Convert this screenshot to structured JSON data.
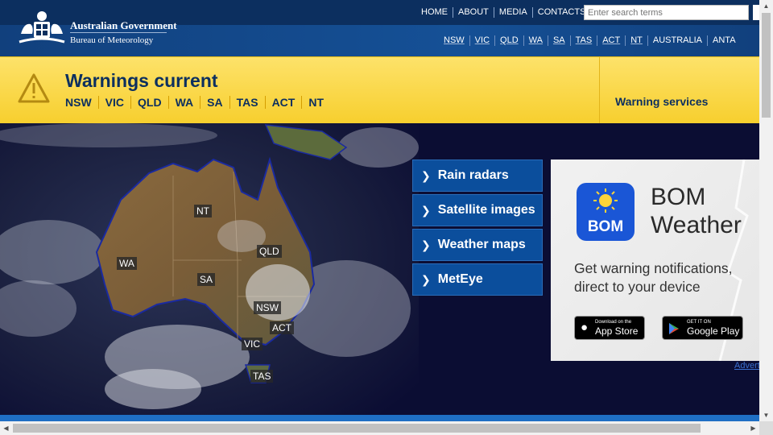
{
  "header": {
    "org_line1": "Australian Government",
    "org_line2": "Bureau of Meteorology",
    "top_links": [
      "HOME",
      "ABOUT",
      "MEDIA",
      "CONTACTS"
    ],
    "search_placeholder": "Enter search terms",
    "state_links": [
      "NSW",
      "VIC",
      "QLD",
      "WA",
      "SA",
      "TAS",
      "ACT",
      "NT",
      "AUSTRALIA",
      "ANTA"
    ]
  },
  "warnings": {
    "title": "Warnings current",
    "states": [
      "NSW",
      "VIC",
      "QLD",
      "WA",
      "SA",
      "TAS",
      "ACT",
      "NT"
    ],
    "services_link": "Warning services"
  },
  "map": {
    "labels": {
      "nt": "NT",
      "wa": "WA",
      "qld": "QLD",
      "sa": "SA",
      "nsw": "NSW",
      "act": "ACT",
      "vic": "VIC",
      "tas": "TAS"
    }
  },
  "menu": [
    "Rain radars",
    "Satellite images",
    "Weather maps",
    "MetEye"
  ],
  "ad": {
    "icon_text": "BOM",
    "title_line1": "BOM",
    "title_line2": "Weather",
    "text": "Get warning notifications, direct to your device",
    "appstore_small": "Download on the",
    "appstore_big": "App Store",
    "play_small": "GET IT ON",
    "play_big": "Google Play",
    "adv_link": "Advert"
  },
  "colors": {
    "header_navy": "#0c2f5f",
    "warning_yellow": "#f7cf2e",
    "menu_blue": "#0b4e9c",
    "app_icon_blue": "#1a56d6"
  }
}
